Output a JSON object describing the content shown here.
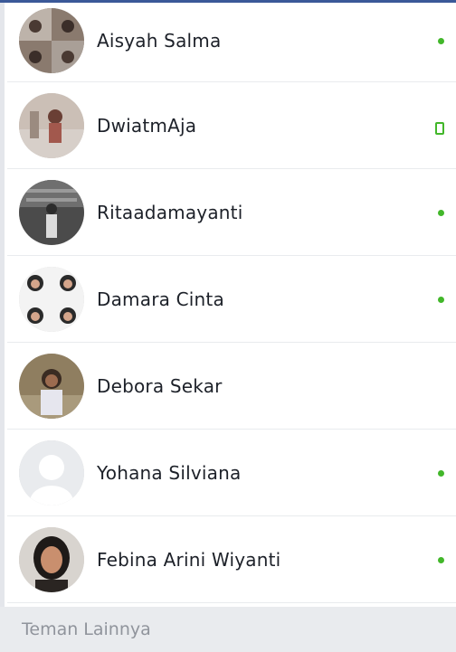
{
  "colors": {
    "accent": "#3b5998",
    "online": "#42b72a",
    "section_bg": "#e9ebee",
    "name_text": "#1d2129",
    "section_text": "#90949c"
  },
  "contacts": [
    {
      "name": "Aisyah Salma",
      "status": "online-dot"
    },
    {
      "name": "DwiatmAja",
      "status": "mobile-icon"
    },
    {
      "name": "Ritaadamayanti",
      "status": "online-dot"
    },
    {
      "name": "Damara Cinta",
      "status": "online-dot"
    },
    {
      "name": "Debora Sekar",
      "status": "none"
    },
    {
      "name": "Yohana Silviana",
      "status": "online-dot"
    },
    {
      "name": "Febina Arini Wiyanti",
      "status": "online-dot"
    }
  ],
  "section": {
    "title": "Teman Lainnya"
  }
}
